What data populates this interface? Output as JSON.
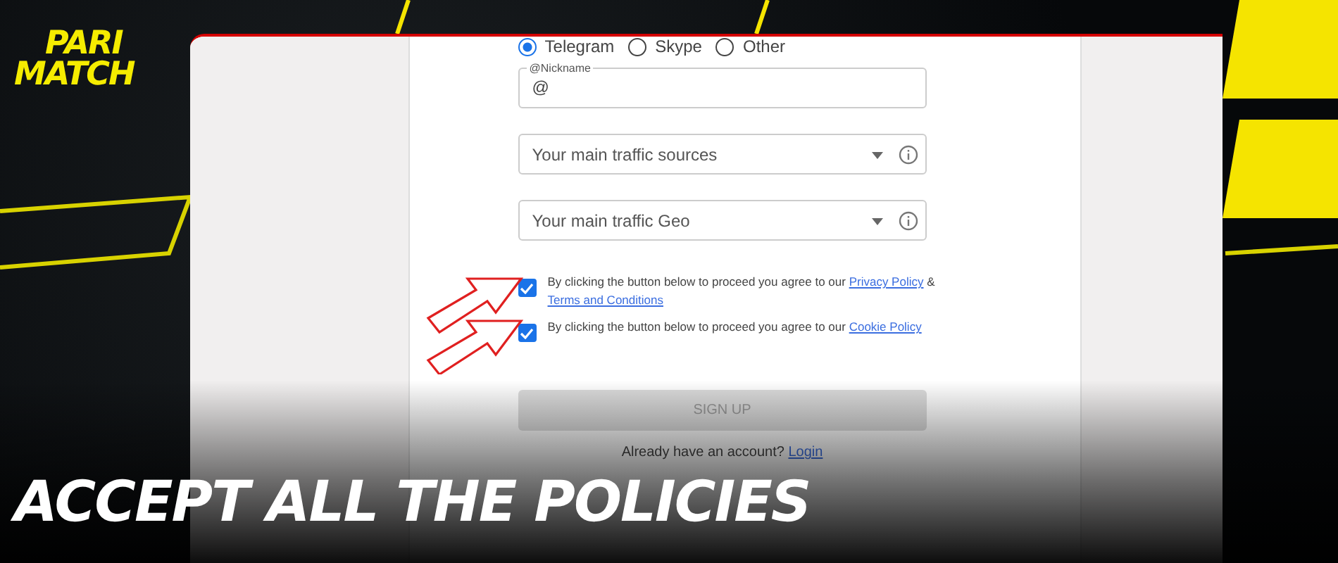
{
  "logo": {
    "lines": [
      "PARI",
      "MATCH"
    ]
  },
  "form": {
    "contact_options": [
      {
        "label": "Telegram",
        "selected": true
      },
      {
        "label": "Skype",
        "selected": false
      },
      {
        "label": "Other",
        "selected": false
      }
    ],
    "nickname": {
      "label": "@Nickname",
      "value": "@"
    },
    "selects": [
      {
        "placeholder": "Your main traffic sources"
      },
      {
        "placeholder": "Your main traffic Geo"
      }
    ],
    "agreements": [
      {
        "checked": true,
        "parts": [
          {
            "kind": "text",
            "text": "By clicking the button below to proceed you agree to our "
          },
          {
            "kind": "link",
            "text": "Privacy Policy"
          },
          {
            "kind": "text",
            "text": " & "
          },
          {
            "kind": "link",
            "text": "Terms and Conditions"
          }
        ]
      },
      {
        "checked": true,
        "parts": [
          {
            "kind": "text",
            "text": "By clicking the button below to proceed you agree to our "
          },
          {
            "kind": "link",
            "text": "Cookie Policy"
          }
        ]
      }
    ],
    "sign_up": {
      "label": "SIGN UP",
      "disabled": true
    },
    "login_prompt": {
      "text": "Already have an account?",
      "link": "Login"
    }
  },
  "caption": "ACCEPT ALL THE POLICIES"
}
